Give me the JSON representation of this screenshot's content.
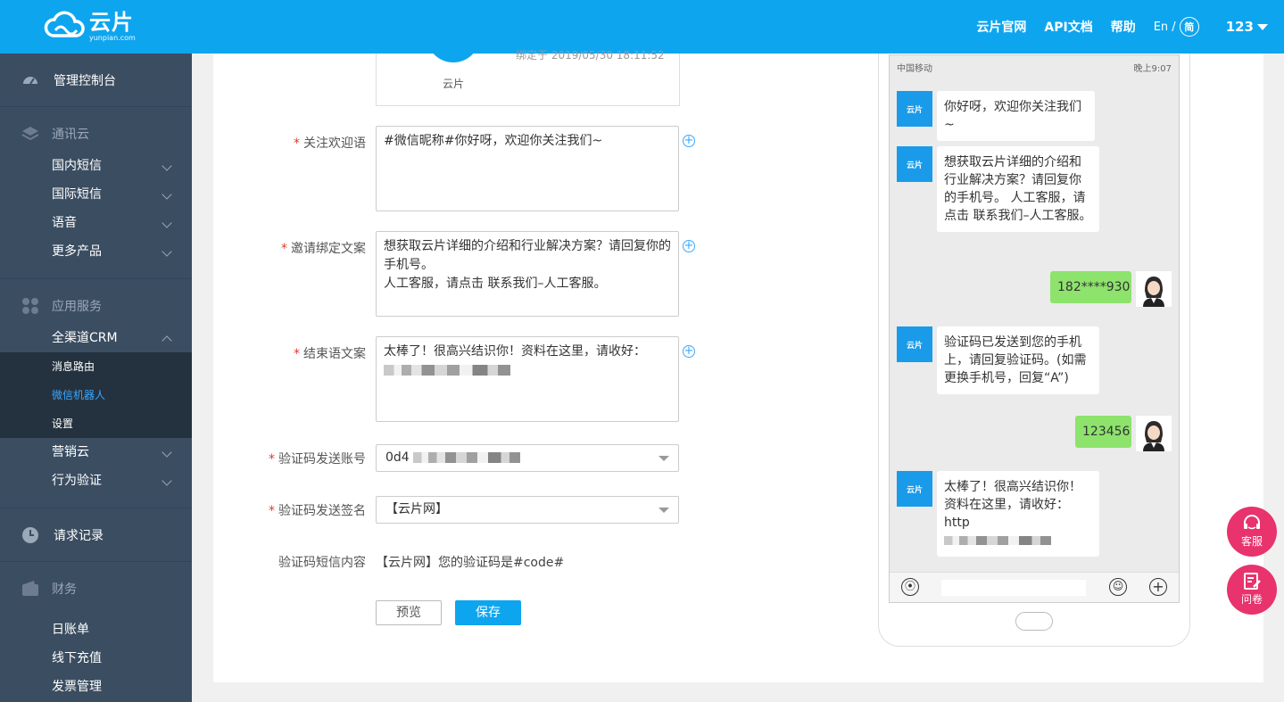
{
  "brand": {
    "name_cn": "云片",
    "name_en": "yunpian.com",
    "primary_color": "#0ea5ef",
    "accent_color": "#e8336d"
  },
  "topnav": {
    "links": [
      "云片官网",
      "API文档",
      "帮助"
    ],
    "lang_en": "En /",
    "lang_cn": "简",
    "user": "123"
  },
  "sidebar": {
    "console": "管理控制台",
    "group_comm": "通讯云",
    "comm_items": [
      "国内短信",
      "国际短信",
      "语音",
      "更多产品"
    ],
    "group_app": "应用服务",
    "crm": "全渠道CRM",
    "crm_sub": [
      "消息路由",
      "微信机器人",
      "设置"
    ],
    "marketing": "营销云",
    "behavior": "行为验证",
    "requests": "请求记录",
    "group_finance": "财务",
    "finance_items": [
      "日账单",
      "线下充值",
      "发票管理"
    ]
  },
  "form": {
    "qr_name": "云片",
    "qr_time": "绑定于 2019/05/30 18:11:52",
    "welcome_label": "关注欢迎语",
    "welcome_value": "#微信昵称#你好呀，欢迎你关注我们~",
    "invite_label": "邀请绑定文案",
    "invite_value": "想获取云片详细的介绍和行业解决方案？请回复你的手机号。\n人工客服，请点击 联系我们–人工客服。",
    "end_label": "结束语文案",
    "end_value": "太棒了！很高兴结识你！资料在这里，请收好：",
    "account_label": "验证码发送账号",
    "account_value": "0d4",
    "sign_label": "验证码发送签名",
    "sign_value": "【云片网】",
    "sms_label": "验证码短信内容",
    "sms_value": "【云片网】您的验证码是#code#",
    "preview_btn": "预览",
    "save_btn": "保存"
  },
  "phone": {
    "carrier": "中国移动",
    "time": "晚上9:07",
    "bot_avatar": "云片",
    "msg1": "你好呀，欢迎你关注我们~",
    "msg2": "想获取云片详细的介绍和行业解决方案？请回复你的手机号。 人工客服，请点击 联系我们–人工客服。",
    "reply1": "182****930",
    "msg3": "验证码已发送到您的手机上，请回复验证码。(如需更换手机号，回复“A”)",
    "reply2": "123456",
    "msg4": "太棒了！很高兴结识你！资料在这里，请收好：http"
  },
  "float": {
    "service": "客服",
    "survey": "问卷"
  }
}
